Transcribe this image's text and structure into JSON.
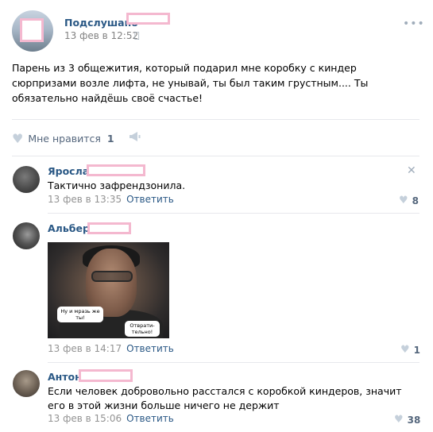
{
  "post": {
    "author": "Подслушано",
    "date": "13 фев в 12:52",
    "text": "Парень из 3 общежития, который подарил мне коробку с киндер сюрпризами возле лифта, не унывай, ты был таким грустным.... Ты обязательно найдёшь своё счастье!",
    "like_label": "Мне нравится",
    "like_count": "1"
  },
  "comments": [
    {
      "name": "Ярослав",
      "text": "Тактично зафрендзонила.",
      "date": "13 фев в 13:35",
      "reply": "Ответить",
      "likes": "8"
    },
    {
      "name": "Альберт",
      "date": "13 фев в 14:17",
      "reply": "Ответить",
      "likes": "1",
      "meme": {
        "bubble_left": "Ну и мразь же ты!",
        "bubble_right": "Отврати-тельно!"
      }
    },
    {
      "name": "Антон",
      "text": "Если человек добровольно расстался с коробкой киндеров, значит его в этой жизни больше ничего не держит",
      "date": "13 фев в 15:06",
      "reply": "Ответить",
      "likes": "38"
    }
  ],
  "icons": {
    "more": "more-icon",
    "heart": "heart-icon",
    "share": "megaphone-icon",
    "close": "close-icon",
    "apple": "apple-icon"
  },
  "colors": {
    "link": "#2a5885",
    "muted": "#939393",
    "redaction": "#f4b8cf"
  }
}
